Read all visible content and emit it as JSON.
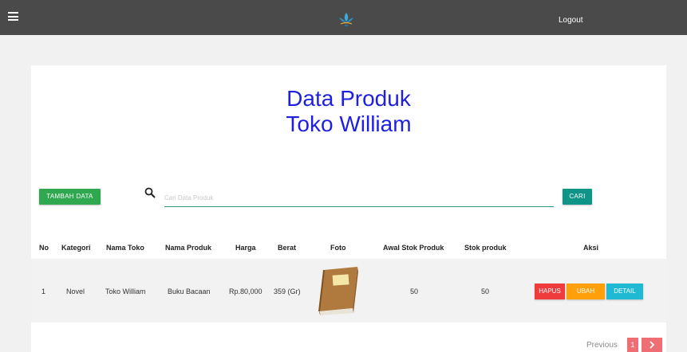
{
  "topbar": {
    "logout_label": "Logout"
  },
  "page": {
    "title_line1": "Data Produk",
    "title_line2": "Toko William"
  },
  "toolbar": {
    "add_label": "TAMBAH DATA",
    "search_placeholder": "Cari Data Produk",
    "search_label": "CARI"
  },
  "table": {
    "headers": [
      "No",
      "Kategori",
      "Nama Toko",
      "Nama Produk",
      "Harga",
      "Berat",
      "Foto",
      "Awal Stok Produk",
      "Stok produk",
      "Aksi"
    ],
    "rows": [
      {
        "no": "1",
        "kategori": "Novel",
        "nama_toko": "Toko William",
        "nama_produk": "Buku Bacaan",
        "harga": "Rp.80,000",
        "berat": "359 (Gr)",
        "foto_icon": "book-icon",
        "awal_stok": "50",
        "stok": "50"
      }
    ],
    "actions": {
      "delete": "HAPUS",
      "edit": "UBAH",
      "detail": "DETAIL"
    }
  },
  "pagination": {
    "previous": "Previous",
    "current": "1"
  },
  "colors": {
    "topbar": "#4a4a4a",
    "title": "#1f1fe0",
    "add": "#2fa84f",
    "search": "#0f9488",
    "delete": "#ef3b3b",
    "edit": "#ff9f0a",
    "detail": "#1fb9d4",
    "pager": "#ee6e73"
  }
}
